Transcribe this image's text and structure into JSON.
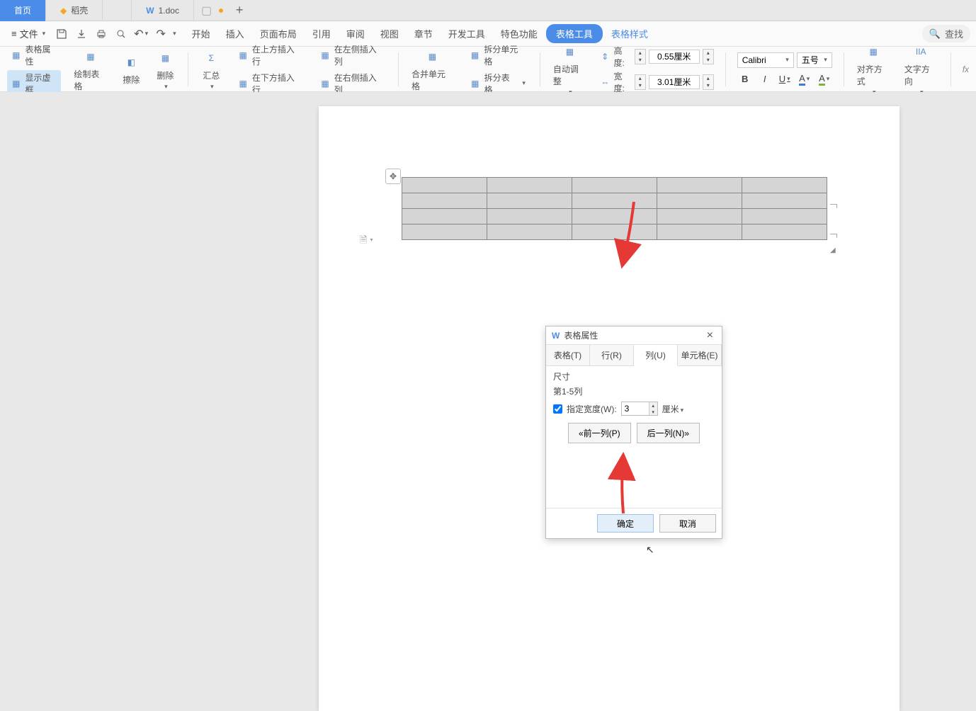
{
  "tabs": {
    "home": "首页",
    "daoke": "稻壳",
    "doc": "1.doc"
  },
  "menu": {
    "file": "文件",
    "items": [
      "开始",
      "插入",
      "页面布局",
      "引用",
      "审阅",
      "视图",
      "章节",
      "开发工具",
      "特色功能"
    ],
    "table_tool": "表格工具",
    "table_style": "表格样式",
    "search": "查找"
  },
  "ribbon": {
    "table_props": "表格属性",
    "show_vframe": "显示虚框",
    "draw_table": "绘制表格",
    "erase": "擦除",
    "delete": "删除",
    "summary": "汇总",
    "insert_above": "在上方插入行",
    "insert_below": "在下方插入行",
    "insert_left": "在左侧插入列",
    "insert_right": "在右侧插入列",
    "merge_cells": "合并单元格",
    "split_cells": "拆分单元格",
    "split_table": "拆分表格",
    "auto_adjust": "自动调整",
    "height_label": "高度:",
    "width_label": "宽度:",
    "height_val": "0.55厘米",
    "width_val": "3.01厘米",
    "font": "Calibri",
    "font_size": "五号",
    "align": "对齐方式",
    "text_dir": "文字方向",
    "fx": "fx"
  },
  "dialog": {
    "title": "表格属性",
    "tabs": {
      "table": "表格(T)",
      "row": "行(R)",
      "col": "列(U)",
      "cell": "单元格(E)"
    },
    "size_label": "尺寸",
    "col_range": "第1-5列",
    "width_check": "指定宽度(W):",
    "width_value": "3",
    "width_unit": "厘米",
    "prev_col": "«前一列(P)",
    "next_col": "后一列(N)»",
    "ok": "确定",
    "cancel": "取消"
  }
}
